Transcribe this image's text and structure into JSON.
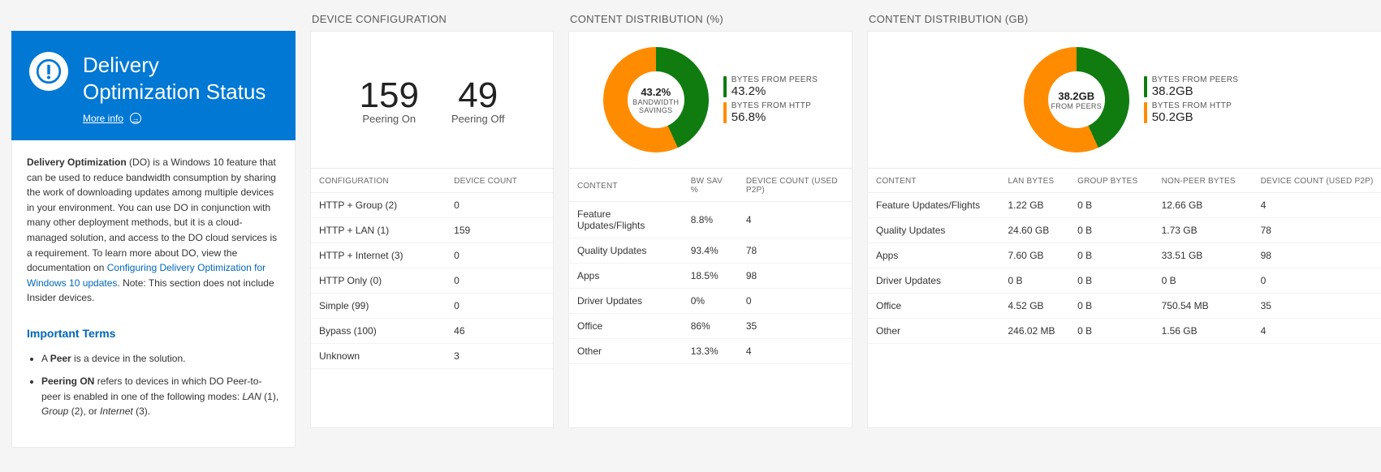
{
  "colors": {
    "blue": "#0078d4",
    "green": "#107c10",
    "orange": "#ff8c00"
  },
  "info": {
    "title": "Delivery Optimization Status",
    "more": "More info",
    "para_bold_lead": "Delivery Optimization",
    "para": " (DO) is a Windows 10 feature that can be used to reduce bandwidth consumption by sharing the work of downloading updates among multiple devices in your environment. You can use DO in conjunction with many other deployment methods, but it is a cloud-managed solution, and access to the DO cloud services is a requirement. To learn more about DO, view the documentation on ",
    "link": "Configuring Delivery Optimization for Windows 10 updates",
    "para_tail": ". Note: This section does not include Insider devices.",
    "terms_hdr": "Important Terms",
    "term1_b": "Peer",
    "term1_rest": " is a device in the solution.",
    "term2_b": "Peering ON",
    "term2_rest": " refers to devices in which DO Peer-to-peer is enabled in one of the following modes: ",
    "term2_m1": "LAN",
    "term2_p1": " (1), ",
    "term2_m2": "Group",
    "term2_p2": " (2), or ",
    "term2_m3": "Internet",
    "term2_p3": " (3)."
  },
  "device_config": {
    "title": "DEVICE CONFIGURATION",
    "peering_on_num": "159",
    "peering_on_lbl": "Peering On",
    "peering_off_num": "49",
    "peering_off_lbl": "Peering Off",
    "cols": {
      "config": "CONFIGURATION",
      "count": "DEVICE COUNT"
    },
    "rows": [
      {
        "config": "HTTP + Group (2)",
        "count": "0"
      },
      {
        "config": "HTTP + LAN (1)",
        "count": "159"
      },
      {
        "config": "HTTP + Internet (3)",
        "count": "0"
      },
      {
        "config": "HTTP Only (0)",
        "count": "0"
      },
      {
        "config": "Simple (99)",
        "count": "0"
      },
      {
        "config": "Bypass (100)",
        "count": "46"
      },
      {
        "config": "Unknown",
        "count": "3"
      }
    ]
  },
  "dist_pct": {
    "title": "CONTENT DISTRIBUTION (%)",
    "center_big": "43.2%",
    "center_sub": "BANDWIDTH SAVINGS",
    "legend": [
      {
        "lbl": "BYTES FROM PEERS",
        "val": "43.2%",
        "cls": "sw-green"
      },
      {
        "lbl": "BYTES FROM HTTP",
        "val": "56.8%",
        "cls": "sw-orange"
      }
    ],
    "cols": {
      "content": "CONTENT",
      "bw": "BW SAV %",
      "dc": "DEVICE COUNT (USED P2P)"
    },
    "rows": [
      {
        "content": "Feature Updates/Flights",
        "bw": "8.8%",
        "dc": "4"
      },
      {
        "content": "Quality Updates",
        "bw": "93.4%",
        "dc": "78"
      },
      {
        "content": "Apps",
        "bw": "18.5%",
        "dc": "98"
      },
      {
        "content": "Driver Updates",
        "bw": "0%",
        "dc": "0"
      },
      {
        "content": "Office",
        "bw": "86%",
        "dc": "35"
      },
      {
        "content": "Other",
        "bw": "13.3%",
        "dc": "4"
      }
    ]
  },
  "dist_gb": {
    "title": "CONTENT DISTRIBUTION (GB)",
    "center_big": "38.2GB",
    "center_sub": "FROM PEERS",
    "legend": [
      {
        "lbl": "BYTES FROM PEERS",
        "val": "38.2GB",
        "cls": "sw-green"
      },
      {
        "lbl": "BYTES FROM HTTP",
        "val": "50.2GB",
        "cls": "sw-orange"
      }
    ],
    "cols": {
      "content": "CONTENT",
      "lan": "LAN BYTES",
      "grp": "GROUP BYTES",
      "np": "NON-PEER BYTES",
      "dc": "DEVICE COUNT (USED P2P)"
    },
    "rows": [
      {
        "content": "Feature Updates/Flights",
        "lan": "1.22 GB",
        "grp": "0 B",
        "np": "12.66 GB",
        "dc": "4"
      },
      {
        "content": "Quality Updates",
        "lan": "24.60 GB",
        "grp": "0 B",
        "np": "1.73 GB",
        "dc": "78"
      },
      {
        "content": "Apps",
        "lan": "7.60 GB",
        "grp": "0 B",
        "np": "33.51 GB",
        "dc": "98"
      },
      {
        "content": "Driver Updates",
        "lan": "0 B",
        "grp": "0 B",
        "np": "0 B",
        "dc": "0"
      },
      {
        "content": "Office",
        "lan": "4.52 GB",
        "grp": "0 B",
        "np": "750.54 MB",
        "dc": "35"
      },
      {
        "content": "Other",
        "lan": "246.02 MB",
        "grp": "0 B",
        "np": "1.56 GB",
        "dc": "4"
      }
    ]
  },
  "chart_data": [
    {
      "type": "pie",
      "title": "Content Distribution (%) — Bandwidth Savings 43.2%",
      "series": [
        {
          "name": "Bytes from Peers",
          "value": 43.2,
          "unit": "%",
          "color": "#107c10"
        },
        {
          "name": "Bytes from HTTP",
          "value": 56.8,
          "unit": "%",
          "color": "#ff8c00"
        }
      ]
    },
    {
      "type": "pie",
      "title": "Content Distribution (GB) — 38.2GB from Peers",
      "series": [
        {
          "name": "Bytes from Peers",
          "value": 38.2,
          "unit": "GB",
          "color": "#107c10"
        },
        {
          "name": "Bytes from HTTP",
          "value": 50.2,
          "unit": "GB",
          "color": "#ff8c00"
        }
      ]
    }
  ]
}
